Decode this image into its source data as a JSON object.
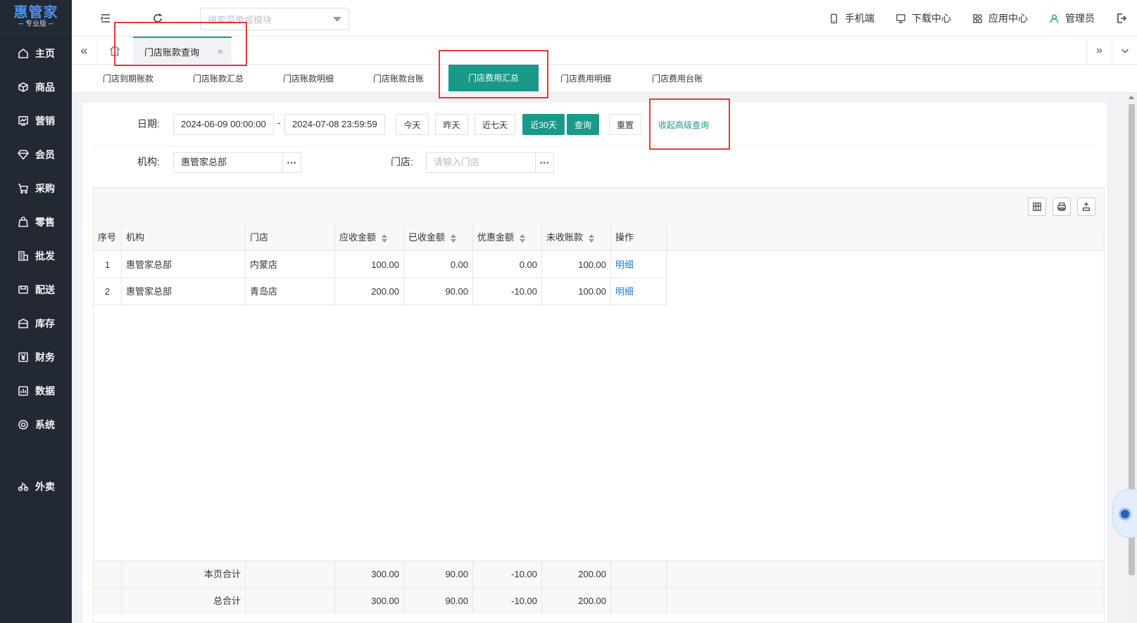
{
  "app": {
    "logo_title": "惠管家",
    "logo_subtitle": "专业版"
  },
  "sidebar": {
    "items": [
      {
        "label": "主页",
        "icon": "home-icon"
      },
      {
        "label": "商品",
        "icon": "box-icon"
      },
      {
        "label": "营销",
        "icon": "chart-icon"
      },
      {
        "label": "会员",
        "icon": "diamond-icon"
      },
      {
        "label": "采购",
        "icon": "cart-icon"
      },
      {
        "label": "零售",
        "icon": "bag-icon"
      },
      {
        "label": "批发",
        "icon": "building-icon"
      },
      {
        "label": "配送",
        "icon": "truck-icon"
      },
      {
        "label": "库存",
        "icon": "warehouse-icon"
      },
      {
        "label": "财务",
        "icon": "yen-icon"
      },
      {
        "label": "数据",
        "icon": "bar-chart-icon"
      },
      {
        "label": "系统",
        "icon": "gear-icon"
      },
      {
        "label": "外卖",
        "icon": "bike-icon"
      }
    ]
  },
  "topbar": {
    "search_placeholder": "搜索菜单或模块",
    "right_items": [
      {
        "label": "手机端",
        "icon": "phone-icon"
      },
      {
        "label": "下载中心",
        "icon": "monitor-icon"
      },
      {
        "label": "应用中心",
        "icon": "apps-icon"
      },
      {
        "label": "管理员",
        "icon": "user-icon"
      }
    ]
  },
  "tabs": {
    "active_label": "门店账款查询",
    "close_glyph": "×",
    "left_arrow": "«",
    "right_arrow": "»",
    "dropdown": "⌄"
  },
  "subtabs": [
    {
      "label": "门店到期账款",
      "active": false
    },
    {
      "label": "门店账款汇总",
      "active": false
    },
    {
      "label": "门店账款明细",
      "active": false
    },
    {
      "label": "门店账款台账",
      "active": false
    },
    {
      "label": "门店费用汇总",
      "active": true
    },
    {
      "label": "门店费用明细",
      "active": false
    },
    {
      "label": "门店费用台账",
      "active": false
    }
  ],
  "filters": {
    "date_label": "日期:",
    "date_start": "2024-06-09 00:00:00",
    "date_sep": "-",
    "date_end": "2024-07-08 23:59:59",
    "btn_today": "今天",
    "btn_yesterday": "昨天",
    "btn_7days": "近七天",
    "btn_30days": "近30天",
    "btn_query": "查询",
    "btn_reset": "重置",
    "advanced_toggle": "收起高级查询",
    "org_label": "机构:",
    "org_value": "惠管家总部",
    "store_label": "门店:",
    "store_placeholder": "请输入门店",
    "more_glyph": "···"
  },
  "table": {
    "columns": [
      "序号",
      "机构",
      "门店",
      "应收金额",
      "已收金额",
      "优惠金额",
      "未收账款",
      "操作"
    ],
    "rows": [
      {
        "no": "1",
        "org": "惠管家总部",
        "store": "内蒙店",
        "receivable": "100.00",
        "received": "0.00",
        "discount": "0.00",
        "unpaid": "100.00",
        "action": "明细"
      },
      {
        "no": "2",
        "org": "惠管家总部",
        "store": "青岛店",
        "receivable": "200.00",
        "received": "90.00",
        "discount": "-10.00",
        "unpaid": "100.00",
        "action": "明细"
      }
    ],
    "page_total": {
      "label": "本页合计",
      "receivable": "300.00",
      "received": "90.00",
      "discount": "-10.00",
      "unpaid": "200.00"
    },
    "grand_total": {
      "label": "总合计",
      "receivable": "300.00",
      "received": "90.00",
      "discount": "-10.00",
      "unpaid": "200.00"
    }
  },
  "colors": {
    "accent": "#1a9988",
    "sidebar_bg": "#222933",
    "link": "#1e7fd6",
    "annotation": "#e23b3b"
  }
}
